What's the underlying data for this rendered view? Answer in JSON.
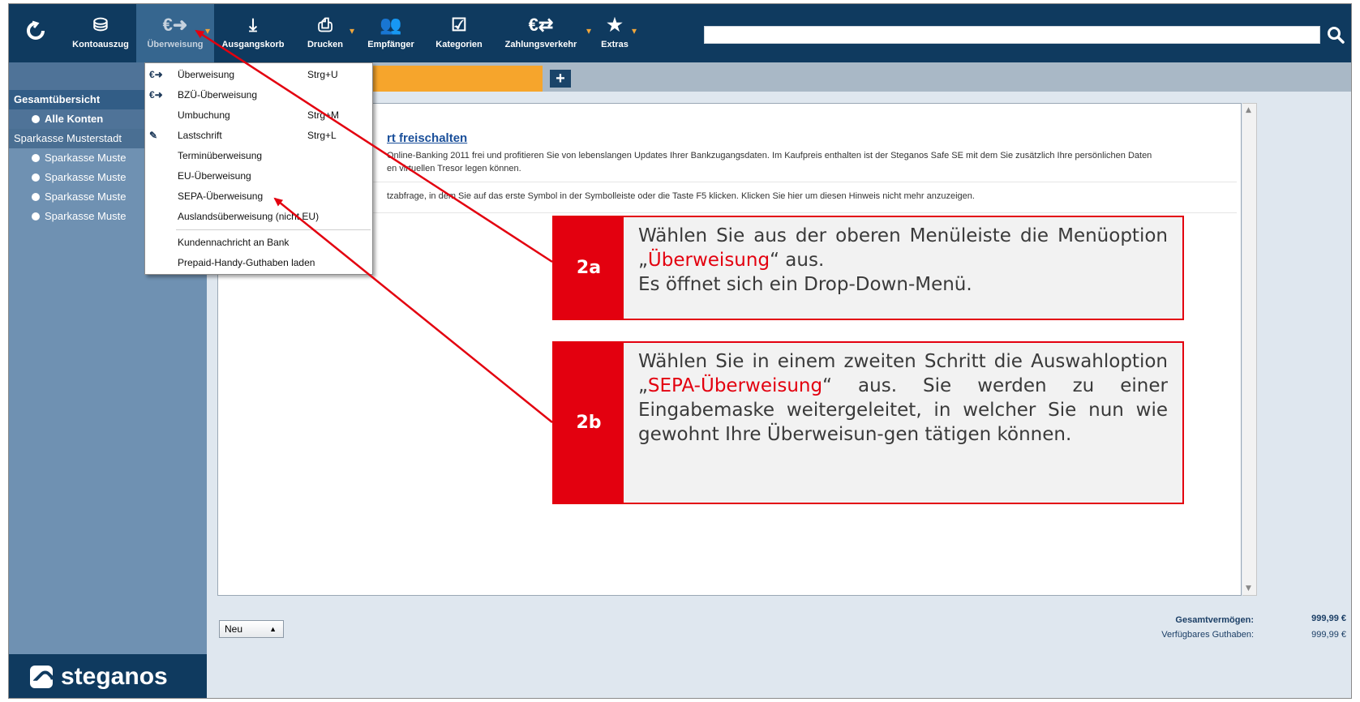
{
  "toolbar": {
    "buttons": [
      {
        "label": "Kontoauszug",
        "icon": "passbook-icon"
      },
      {
        "label": "Überweisung",
        "icon": "euro-transfer-icon"
      },
      {
        "label": "Ausgangskorb",
        "icon": "outbox-icon"
      },
      {
        "label": "Drucken",
        "icon": "printer-icon"
      },
      {
        "label": "Empfänger",
        "icon": "recipients-icon"
      },
      {
        "label": "Kategorien",
        "icon": "categories-icon"
      },
      {
        "label": "Zahlungsverkehr",
        "icon": "euro-exchange-icon"
      },
      {
        "label": "Extras",
        "icon": "star-icon"
      }
    ],
    "search_value": ""
  },
  "sidebar": {
    "overview": "Gesamtübersicht",
    "all_accounts": "Alle Konten",
    "bank": "Sparkasse Musterstadt",
    "accounts": [
      "Sparkasse Muste",
      "Sparkasse Muste",
      "Sparkasse Muste",
      "Sparkasse Muste"
    ],
    "logo": "steganos"
  },
  "menu": {
    "items": [
      {
        "label": "Überweisung",
        "shortcut": "Strg+U",
        "icon": "euro-arrow-icon"
      },
      {
        "label": "BZÜ-Überweisung",
        "shortcut": "",
        "icon": "euro-arrow-icon"
      },
      {
        "label": "Umbuchung",
        "shortcut": "Strg+M",
        "icon": ""
      },
      {
        "label": "Lastschrift",
        "shortcut": "Strg+L",
        "icon": "debit-icon"
      },
      {
        "label": "Terminüberweisung",
        "shortcut": "",
        "icon": ""
      },
      {
        "label": "EU-Überweisung",
        "shortcut": "",
        "icon": ""
      },
      {
        "label": "SEPA-Überweisung",
        "shortcut": "",
        "icon": ""
      },
      {
        "label": "Auslandsüberweisung (nicht EU)",
        "shortcut": "",
        "icon": ""
      },
      {
        "label": "Kundennachricht an Bank",
        "shortcut": "",
        "icon": ""
      },
      {
        "label": "Prepaid-Handy-Guthaben laden",
        "shortcut": "",
        "icon": ""
      }
    ]
  },
  "content": {
    "link_title": "rt freischalten",
    "notice_line1": "Online-Banking 2011 frei und profitieren Sie von lebenslangen Updates Ihrer Bankzugangsdaten. Im Kaufpreis enthalten ist der Steganos Safe SE mit dem Sie zusätzlich Ihre persönlichen Daten",
    "notice_line2": "en virtuellen Tresor legen können.",
    "notice_line3": "tzabfrage, in dem Sie auf das erste Symbol in der Symbolleiste oder die Taste F5 klicken. Klicken Sie hier um diesen Hinweis nicht mehr anzuzeigen."
  },
  "footer": {
    "new_button": "Neu",
    "total_label": "Gesamtvermögen:",
    "total_value": "999,99 €",
    "available_label": "Verfügbares Guthaben:",
    "available_value": "999,99 €"
  },
  "callouts": {
    "a": {
      "number": "2a",
      "text_before": "Wählen Sie aus der oberen Menüleiste die Menüoption „",
      "highlight": "Überweisung",
      "text_after": "“ aus.",
      "line2": "Es öffnet sich ein Drop-Down-Menü."
    },
    "b": {
      "number": "2b",
      "text_before": "Wählen Sie in einem zweiten Schritt die Auswahloption „",
      "highlight": "SEPA-Überweisung",
      "text_after": "“ aus. Sie werden zu einer Eingabemaske weitergeleitet, in welcher Sie nun wie gewohnt Ihre Überweisun-gen tätigen können."
    }
  },
  "colors": {
    "toolbar": "#0f3a5f",
    "accent_orange": "#f6a52c",
    "callout_red": "#e3000f"
  }
}
